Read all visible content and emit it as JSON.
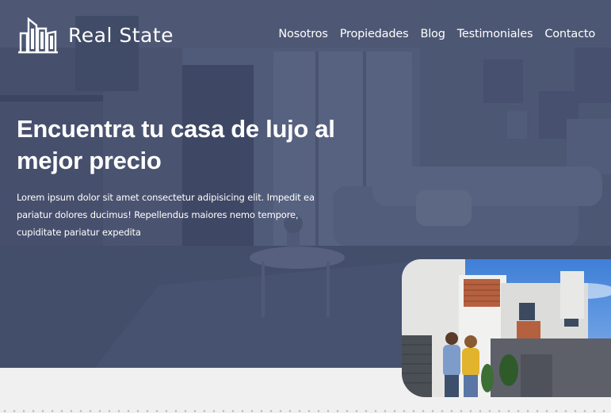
{
  "brand": {
    "name": "Real State",
    "logo_icon": "buildings-icon"
  },
  "nav": {
    "items": [
      {
        "label": "Nosotros"
      },
      {
        "label": "Propiedades"
      },
      {
        "label": "Blog"
      },
      {
        "label": "Testimoniales"
      },
      {
        "label": "Contacto"
      }
    ]
  },
  "hero": {
    "headline": "Encuentra tu casa de lujo al mejor precio",
    "lede": "Lorem ipsum dolor sit amet consectetur adipisicing elit. Impedit ea pariatur dolores ducimus! Repellendus maiores nemo tempore, cupiditate pariatur expedita"
  },
  "colors": {
    "overlay": "#3a4664",
    "text": "#ffffff",
    "page_bg": "#f0f0f0"
  }
}
